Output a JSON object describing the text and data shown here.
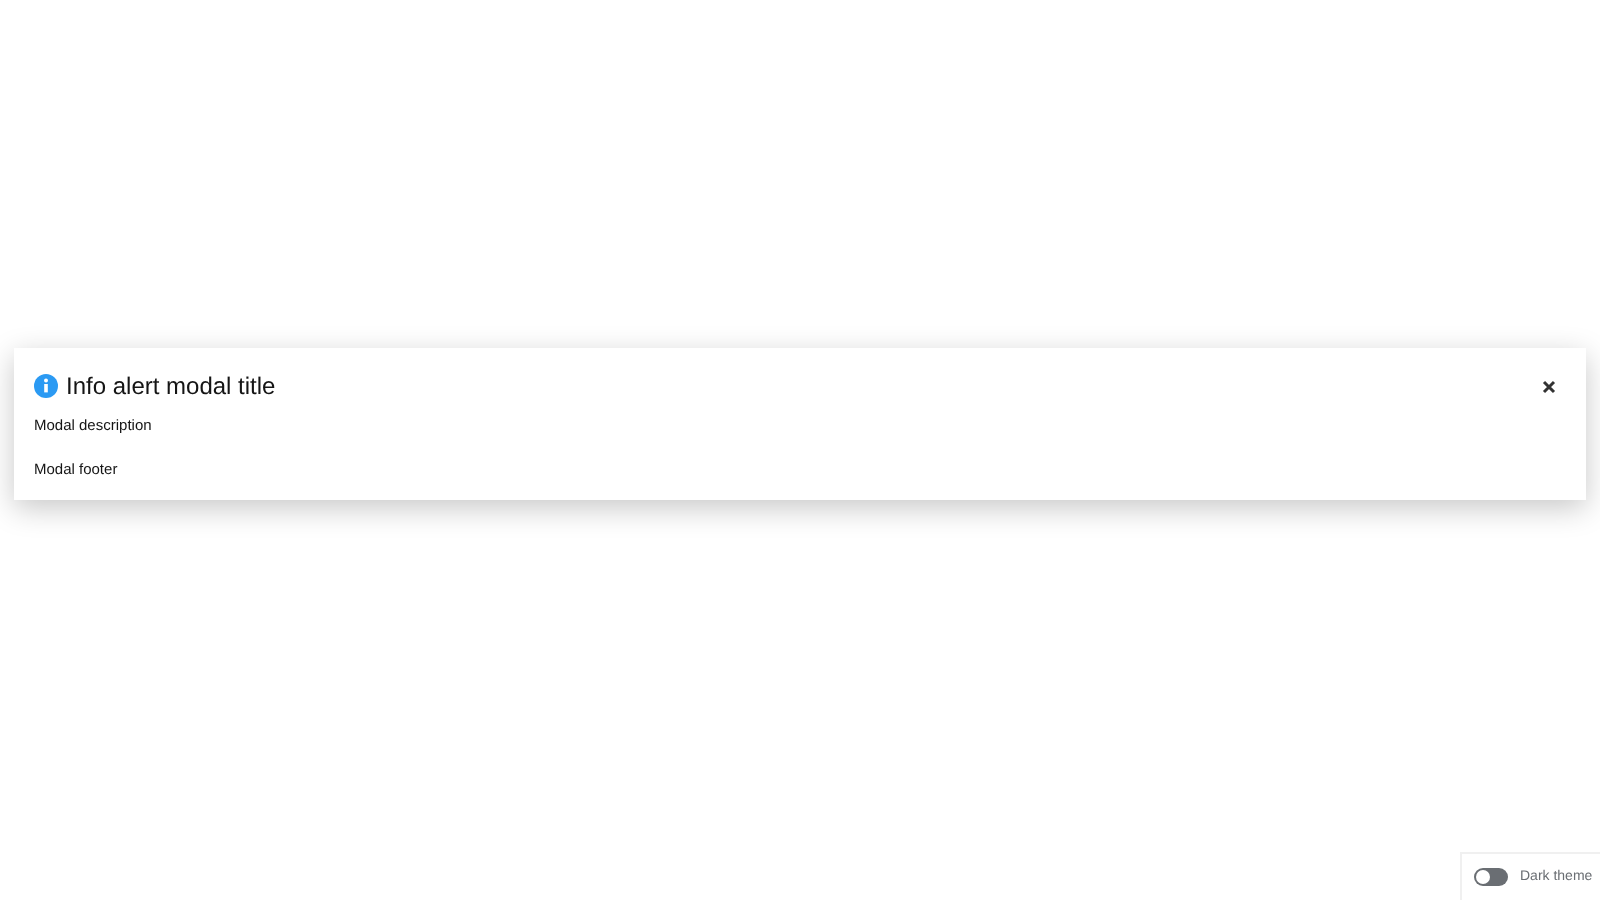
{
  "modal": {
    "kind": "info",
    "title": "Info alert modal title",
    "description": "Modal description",
    "footer": "Modal footer"
  },
  "theme_toggle": {
    "label": "Dark theme",
    "on": false
  }
}
